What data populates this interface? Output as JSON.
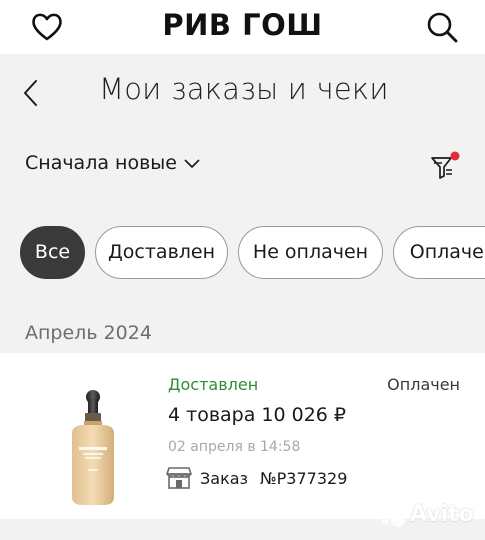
{
  "header": {
    "brand": "РИВ ГОШ",
    "favorites_icon": "heart-icon",
    "search_icon": "search-icon"
  },
  "page": {
    "back_icon": "chevron-left-icon",
    "title": "Мои заказы и чеки"
  },
  "sort": {
    "label": "Сначала новые",
    "dropdown_icon": "chevron-down-icon",
    "filter_icon": "filter-icon",
    "filter_active_dot_color": "#e8283c"
  },
  "chips": [
    {
      "label": "Все",
      "active": true
    },
    {
      "label": "Доставлен",
      "active": false
    },
    {
      "label": "Не оплачен",
      "active": false
    },
    {
      "label": "Оплачен",
      "active": false
    }
  ],
  "group": {
    "month": "Апрель 2024"
  },
  "order": {
    "product_image": "foundation-bottle-image",
    "delivery_status": "Доставлен",
    "delivery_status_color": "#2f8a3a",
    "payment_status": "Оплачен",
    "summary": "4 товара 10 026 ₽",
    "date": "02 апреля в 14:58",
    "store_icon": "store-icon",
    "order_label": "Заказ",
    "order_number": "№P377329"
  },
  "watermark": {
    "text": "Avito"
  }
}
